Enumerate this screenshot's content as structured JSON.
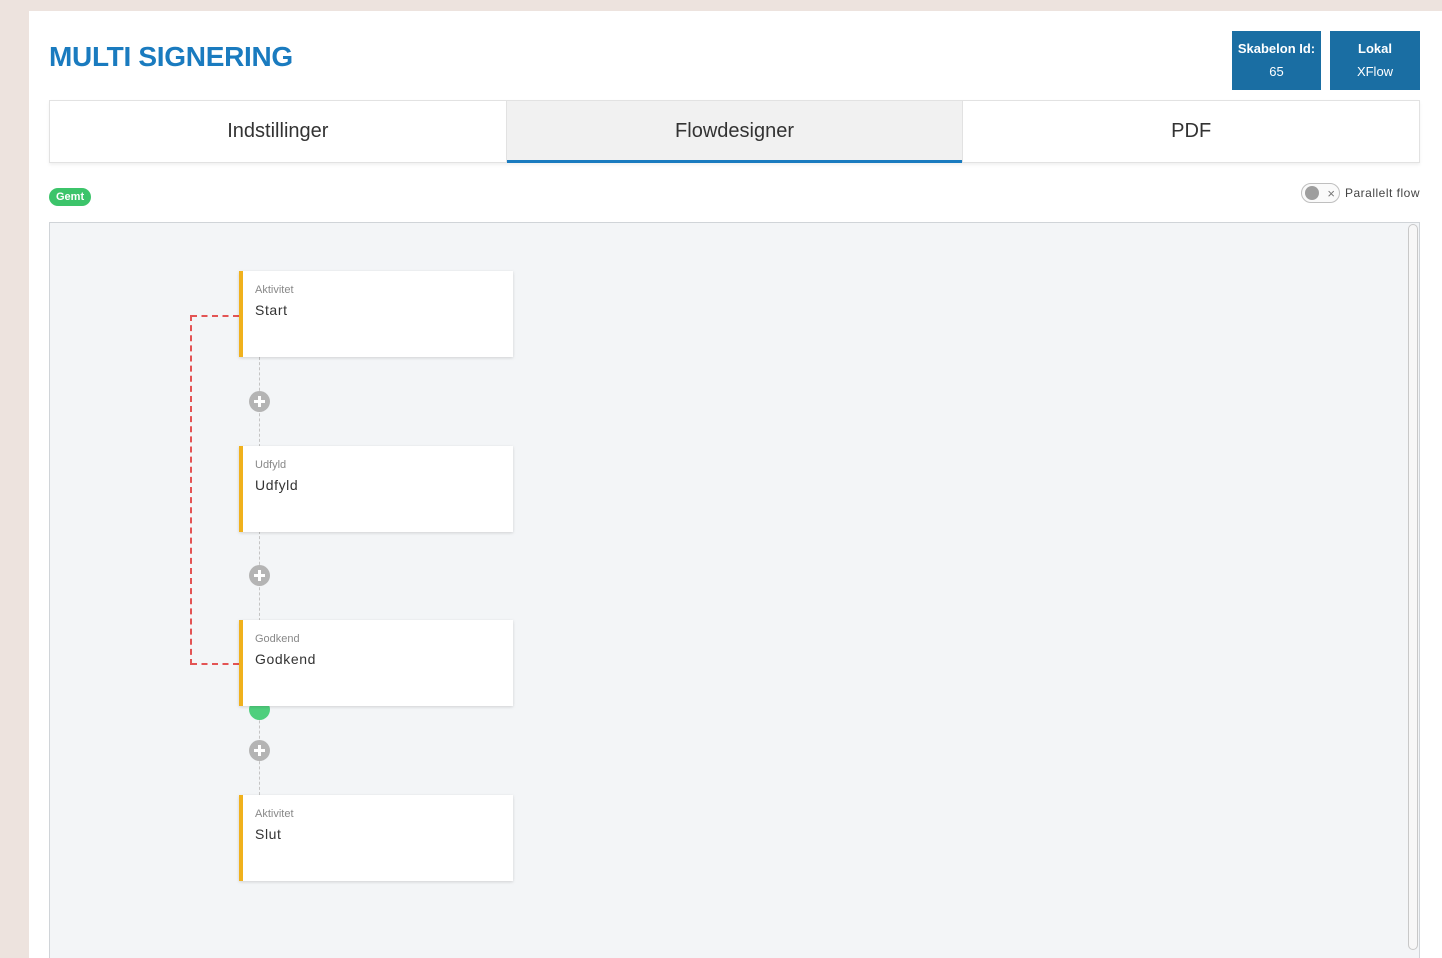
{
  "header": {
    "title": "MULTI SIGNERING",
    "template_box": {
      "label": "Skabelon Id:",
      "value": "65"
    },
    "source_box": {
      "label": "Lokal",
      "value": "XFlow"
    }
  },
  "tabs": [
    {
      "label": "Indstillinger",
      "active": false
    },
    {
      "label": "Flowdesigner",
      "active": true
    },
    {
      "label": "PDF",
      "active": false
    }
  ],
  "status": {
    "badge": "Gemt",
    "badge_color": "#3cc46a"
  },
  "parallel_toggle": {
    "label": "Parallelt flow",
    "enabled": false,
    "off_symbol": "×"
  },
  "flow": {
    "nodes": [
      {
        "type": "Aktivitet",
        "name": "Start"
      },
      {
        "type": "Udfyld",
        "name": "Udfyld"
      },
      {
        "type": "Godkend",
        "name": "Godkend"
      },
      {
        "type": "Aktivitet",
        "name": "Slut"
      }
    ],
    "loop_color": "#e35454",
    "node_accent": "#f0b11d"
  },
  "colors": {
    "brand": "#1a7bbf",
    "info_box": "#1a6ea3"
  }
}
